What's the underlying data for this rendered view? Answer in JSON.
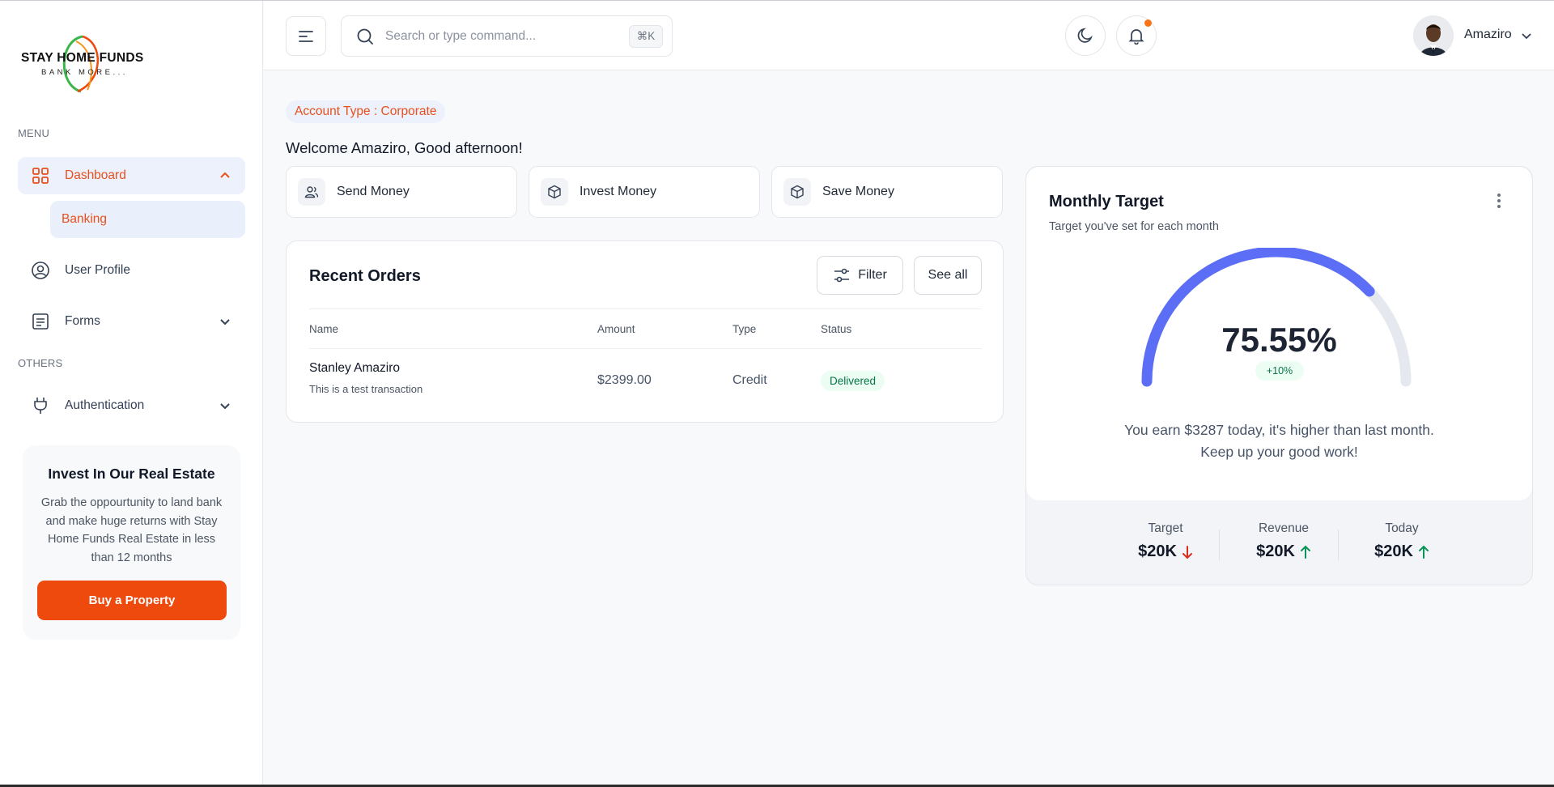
{
  "brand": {
    "name": "STAY HOME FUNDS",
    "tagline": "BANK MORE...",
    "accent": "#ee4a0e"
  },
  "sidebar": {
    "menu_label": "MENU",
    "others_label": "OTHERS",
    "items": [
      {
        "label": "Dashboard",
        "icon": "grid-icon",
        "active": true,
        "expanded": true
      },
      {
        "label": "Banking",
        "sub": true,
        "active": true
      },
      {
        "label": "User Profile",
        "icon": "user-circle-icon"
      },
      {
        "label": "Forms",
        "icon": "list-icon",
        "has_children": true
      },
      {
        "label": "Authentication",
        "icon": "plug-icon",
        "has_children": true
      }
    ],
    "promo": {
      "title": "Invest In Our Real Estate",
      "body": "Grab the oppourtunity to land bank and make huge returns with Stay Home Funds Real Estate in less than 12 months",
      "button": "Buy a Property"
    }
  },
  "header": {
    "search_placeholder": "Search or type command...",
    "search_shortcut": "⌘K",
    "user_name": "Amaziro",
    "has_notification": true
  },
  "main": {
    "account_type": "Account Type : Corporate",
    "welcome": "Welcome Amaziro, Good afternoon!",
    "actions": [
      {
        "label": "Send Money",
        "icon": "users-icon"
      },
      {
        "label": "Invest Money",
        "icon": "box-icon"
      },
      {
        "label": "Save Money",
        "icon": "box-icon"
      }
    ],
    "orders": {
      "title": "Recent Orders",
      "filter_label": "Filter",
      "see_all_label": "See all",
      "columns": [
        "Name",
        "Amount",
        "Type",
        "Status"
      ],
      "rows": [
        {
          "name": "Stanley Amaziro",
          "desc": "This is a test transaction",
          "amount": "$2399.00",
          "type": "Credit",
          "status": "Delivered"
        }
      ]
    },
    "target": {
      "title": "Monthly Target",
      "subtitle": "Target you've set for each month",
      "percent": 75.55,
      "percent_label": "75.55%",
      "delta": "+10%",
      "message_line1": "You earn $3287 today, it's higher than last month.",
      "message_line2": "Keep up your good work!",
      "gauge_color": "#5b6ef5",
      "track_color": "#e5e8ee",
      "stats": [
        {
          "label": "Target",
          "value": "$20K",
          "trend": "down",
          "color": "#d92d20"
        },
        {
          "label": "Revenue",
          "value": "$20K",
          "trend": "up",
          "color": "#079455"
        },
        {
          "label": "Today",
          "value": "$20K",
          "trend": "up",
          "color": "#079455"
        }
      ]
    }
  }
}
